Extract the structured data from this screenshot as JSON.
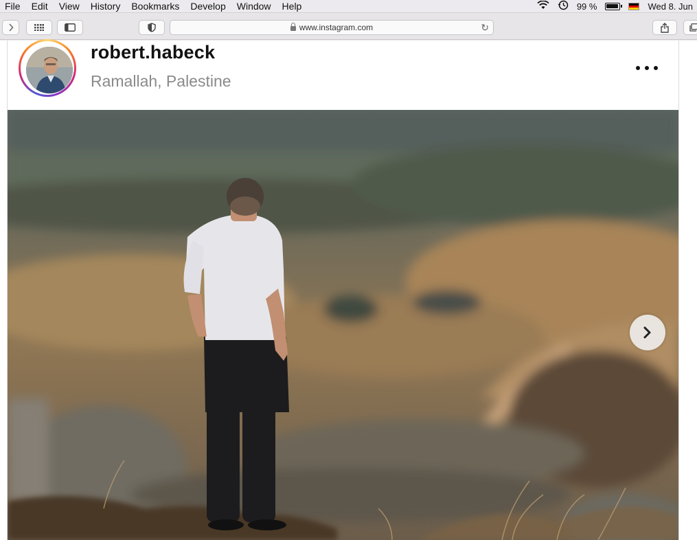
{
  "menubar": {
    "items": [
      "File",
      "Edit",
      "View",
      "History",
      "Bookmarks",
      "Develop",
      "Window",
      "Help"
    ],
    "battery": "99 %",
    "datetime": "Wed 8. Jun",
    "icons": [
      "wifi-icon",
      "time-machine-icon",
      "battery-icon",
      "flag-de-icon"
    ]
  },
  "toolbar": {
    "url": "www.instagram.com",
    "icons": [
      "forward-icon",
      "grid-icon",
      "sidebar-icon",
      "privacy-shield-icon",
      "lock-icon",
      "reload-icon",
      "share-icon",
      "tabs-icon"
    ]
  },
  "post": {
    "username": "robert.habeck",
    "location": "Ramallah, Palestine",
    "more_icon": "more-options-icon",
    "next_icon": "chevron-right-icon"
  },
  "colors": {
    "story_ring": "#d62976",
    "username": "#111111",
    "location": "#8a8a8a"
  }
}
